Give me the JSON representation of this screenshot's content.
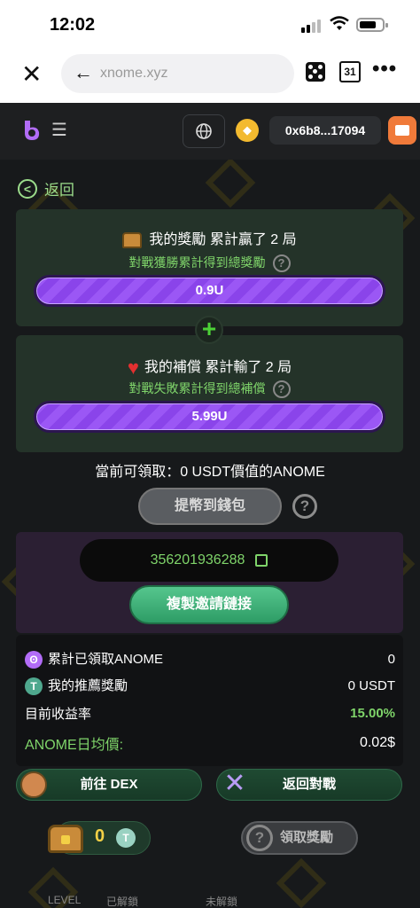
{
  "status_bar": {
    "time": "12:02"
  },
  "browser": {
    "url": "xnome.xyz",
    "tab_count": "31"
  },
  "header": {
    "wallet_address": "0x6b8...17094"
  },
  "back": {
    "label": "返回"
  },
  "reward_card": {
    "title": "我的獎勵 累計贏了 2 局",
    "subtitle": "對戰獲勝累計得到總獎勵",
    "amount": "0.9U"
  },
  "compensation_card": {
    "title": "我的補償 累計輸了 2 局",
    "subtitle": "對戰失敗累計得到總補償",
    "amount": "5.99U"
  },
  "claimable": {
    "text": "當前可領取：0 USDT價值的ANOME"
  },
  "withdraw": {
    "label": "提幣到錢包"
  },
  "invite": {
    "code": "356201936288",
    "copy_label": "複製邀請鏈接"
  },
  "stats": {
    "rows": [
      {
        "label": "累計已領取ANOME",
        "value": "0"
      },
      {
        "label": "我的推薦獎勵",
        "value": "0 USDT"
      },
      {
        "label": "目前收益率",
        "value": "15.00%"
      },
      {
        "label": "ANOME日均價:",
        "value": "0.02$"
      }
    ]
  },
  "actions": {
    "dex_label": "前往 DEX",
    "back_battle_label": "返回對戰"
  },
  "bottom": {
    "chest_count": "0",
    "claim_label": "領取獎勵"
  },
  "footer": {
    "tabs": [
      "LEVEL",
      "已解鎖",
      "未解鎖"
    ]
  },
  "colors": {
    "accent_green": "#7fd46a",
    "bar_purple": "#9b57f5",
    "bg": "#17191b"
  }
}
